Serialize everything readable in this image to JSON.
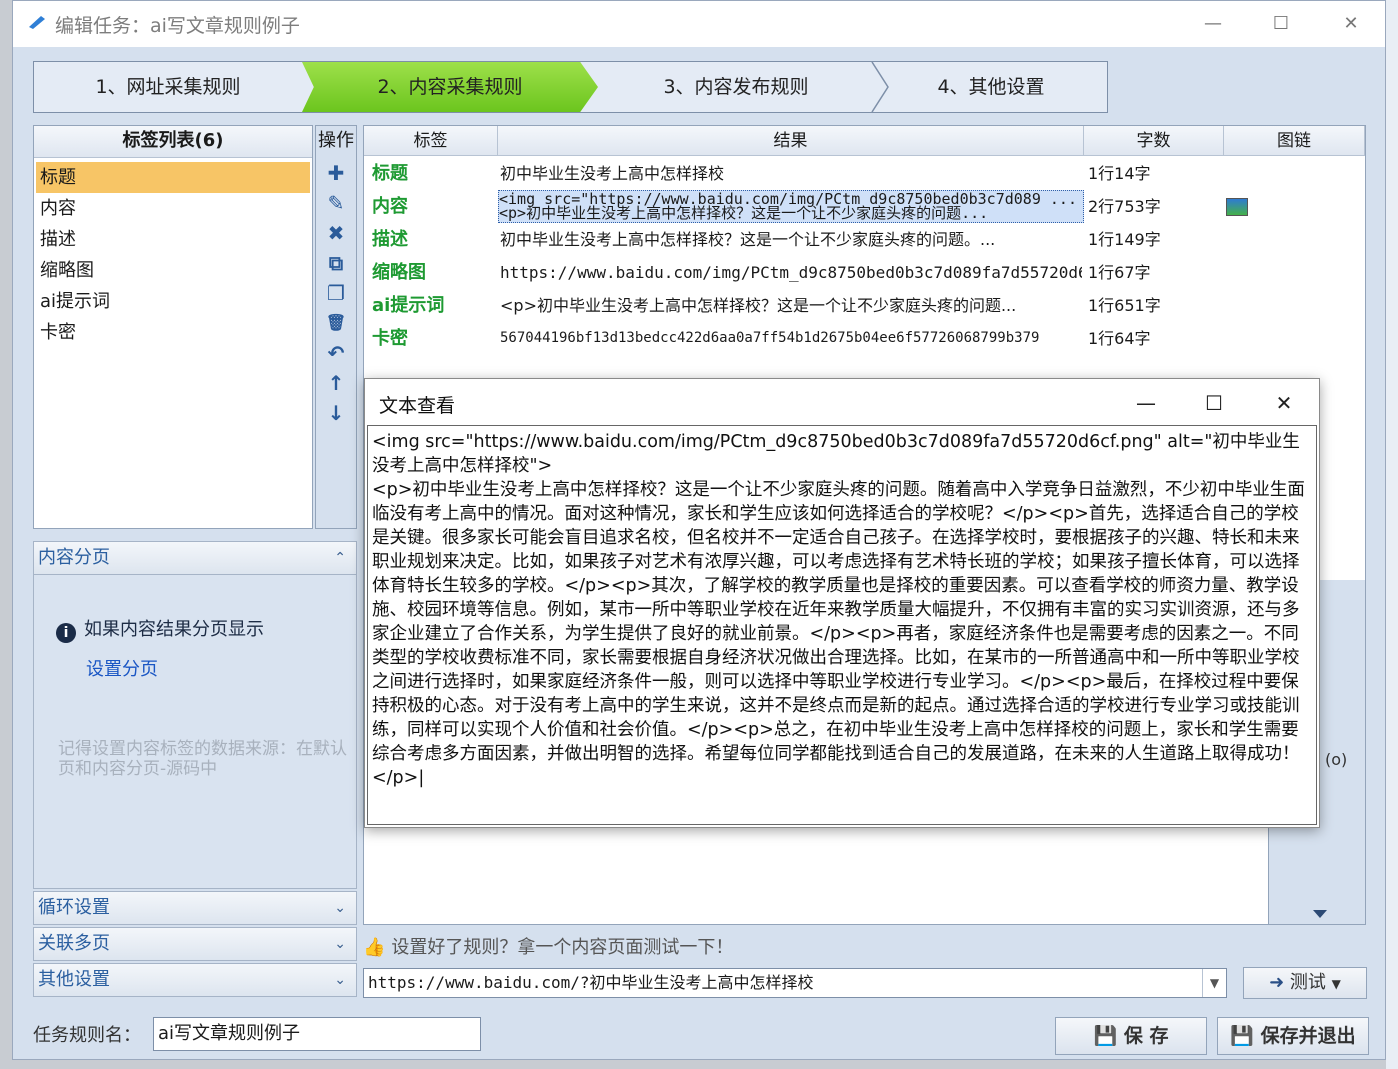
{
  "window": {
    "title": "编辑任务：ai写文章规则例子",
    "minimize": "—",
    "maximize": "☐",
    "close": "✕"
  },
  "steps": [
    {
      "label": "1、网址采集规则"
    },
    {
      "label": "2、内容采集规则"
    },
    {
      "label": "3、内容发布规则"
    },
    {
      "label": "4、其他设置"
    }
  ],
  "tag_list": {
    "header": "标签列表(6)",
    "items": [
      "标题",
      "内容",
      "描述",
      "缩略图",
      "ai提示词",
      "卡密"
    ]
  },
  "ops": {
    "header": "操作",
    "icons": [
      "✚",
      "✎",
      "✖",
      "⧉",
      "❐",
      "🗑",
      "↶",
      "↑",
      "↓"
    ]
  },
  "accordion": {
    "content_paging": "内容分页",
    "paging_info": "如果内容结果分页显示",
    "paging_link": "设置分页",
    "paging_note": "记得设置内容标签的数据来源：在默认页和内容分页-源码中",
    "loop": "循环设置",
    "linked": "关联多页",
    "other": "其他设置"
  },
  "grid": {
    "columns": [
      "标签",
      "结果",
      "字数",
      "图链"
    ],
    "rows": [
      {
        "tag": "标题",
        "result": "初中毕业生没考上高中怎样择校",
        "count": "1行14字"
      },
      {
        "tag": "内容",
        "result": "<img src=\"https://www.baidu.com/img/PCtm_d9c8750bed0b3c7d089 ...",
        "result2": "<p>初中毕业生没考上高中怎样择校？这是一个让不少家庭头疼的问题...",
        "count": "2行753字"
      },
      {
        "tag": "描述",
        "result": "初中毕业生没考上高中怎样择校？这是一个让不少家庭头疼的问题。...",
        "count": "1行149字"
      },
      {
        "tag": "缩略图",
        "result": "https://www.baidu.com/img/PCtm_d9c8750bed0b3c7d089fa7d55720d6...",
        "count": "1行67字"
      },
      {
        "tag": "ai提示词",
        "result": "<p>初中毕业生没考上高中怎样择校？这是一个让不少家庭头疼的问题...",
        "count": "1行651字"
      },
      {
        "tag": "卡密",
        "result": "567044196bf13d13bedcc422d6aa0a7ff54b1d2675b04ee6f57726068799b379",
        "count": "1行64字"
      }
    ],
    "side_label": "(o)"
  },
  "test": {
    "hint": "设置好了规则？拿一个内容页面测试一下！",
    "url": "https://www.baidu.com/?初中毕业生没考上高中怎样择校",
    "button": "测试"
  },
  "bottom": {
    "rule_label": "任务规则名：",
    "rule_value": "ai写文章规则例子",
    "save": "保 存",
    "save_exit": "保存并退出"
  },
  "dialog": {
    "title": "文本查看",
    "minimize": "—",
    "maximize": "☐",
    "close": "✕",
    "text": "<img src=\"https://www.baidu.com/img/PCtm_d9c8750bed0b3c7d089fa7d55720d6cf.png\" alt=\"初中毕业生没考上高中怎样择校\">\n<p>初中毕业生没考上高中怎样择校？这是一个让不少家庭头疼的问题。随着高中入学竞争日益激烈，不少初中毕业生面临没有考上高中的情况。面对这种情况，家长和学生应该如何选择适合的学校呢？</p><p>首先，选择适合自己的学校是关键。很多家长可能会盲目追求名校，但名校并不一定适合自己孩子。在选择学校时，要根据孩子的兴趣、特长和未来职业规划来决定。比如，如果孩子对艺术有浓厚兴趣，可以考虑选择有艺术特长班的学校；如果孩子擅长体育，可以选择体育特长生较多的学校。</p><p>其次，了解学校的教学质量也是择校的重要因素。可以查看学校的师资力量、教学设施、校园环境等信息。例如，某市一所中等职业学校在近年来教学质量大幅提升，不仅拥有丰富的实习实训资源，还与多家企业建立了合作关系，为学生提供了良好的就业前景。</p><p>再者，家庭经济条件也是需要考虑的因素之一。不同类型的学校收费标准不同，家长需要根据自身经济状况做出合理选择。比如，在某市的一所普通高中和一所中等职业学校之间进行选择时，如果家庭经济条件一般，则可以选择中等职业学校进行专业学习。</p><p>最后，在择校过程中要保持积极的心态。对于没有考上高中的学生来说，这并不是终点而是新的起点。通过选择合适的学校进行专业学习或技能训练，同样可以实现个人价值和社会价值。</p><p>总之，在初中毕业生没考上高中怎样择校的问题上，家长和学生需要综合考虑多方面因素，并做出明智的选择。希望每位同学都能找到适合自己的发展道路，在未来的人生道路上取得成功！</p>|"
  },
  "colors": {
    "active_step": "#7fd02c",
    "selected_tag": "#f7c566",
    "tag_label": "#1e9a32",
    "link": "#1a56c4"
  }
}
